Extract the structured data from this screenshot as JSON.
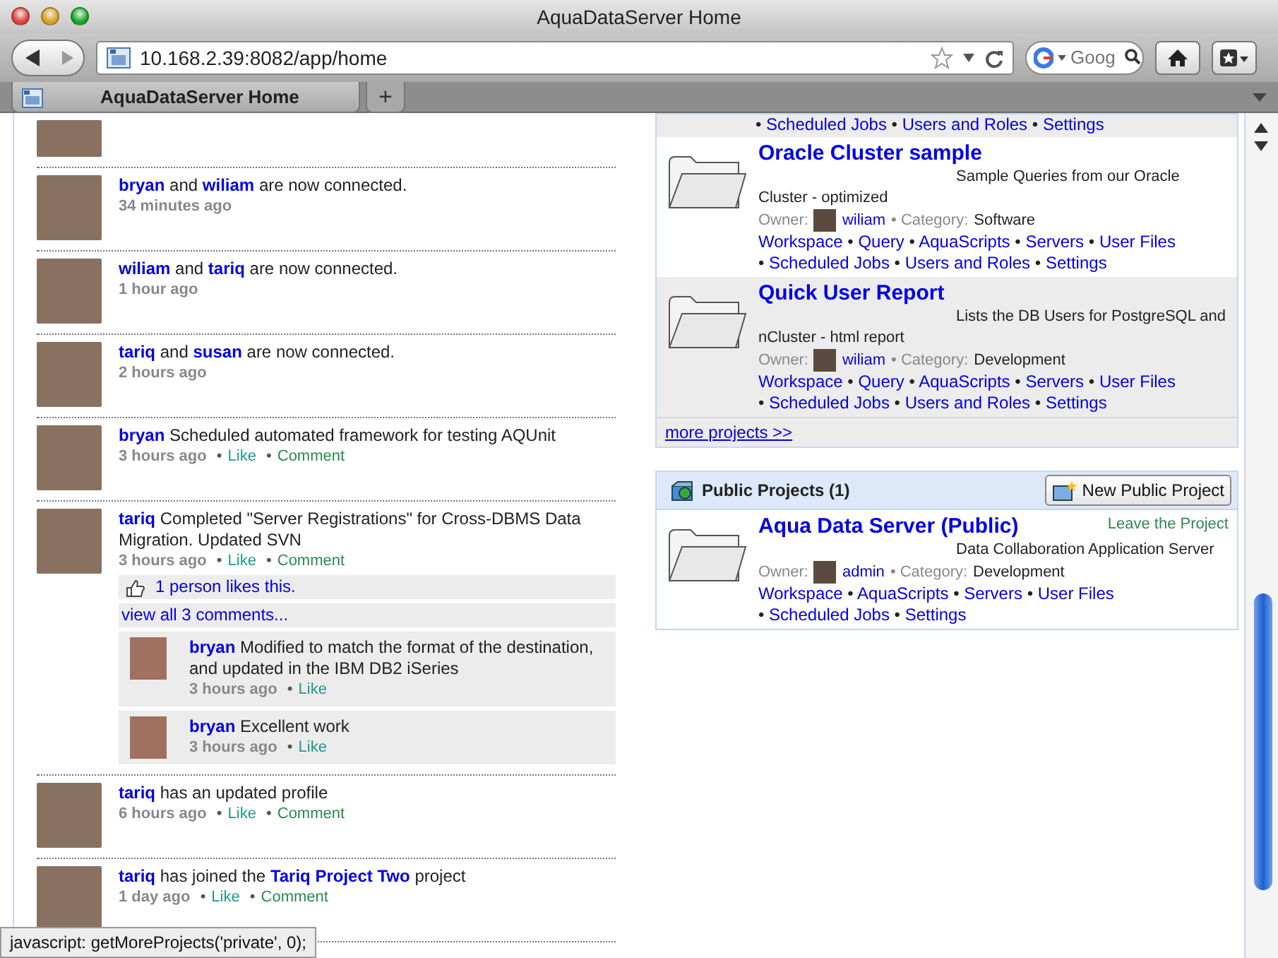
{
  "browser": {
    "title": "AquaDataServer Home",
    "url": "10.168.2.39:8082/app/home",
    "search_placeholder": "Goog",
    "tabs": [
      {
        "label": "AquaDataServer Home",
        "selected": true
      }
    ],
    "new_tab": "+"
  },
  "feed": [
    {
      "kind": "cut"
    },
    {
      "kind": "post",
      "segments": [
        {
          "kind": "user",
          "text": "bryan"
        },
        {
          "kind": "text",
          "text": "and"
        },
        {
          "kind": "user",
          "text": "wiliam"
        },
        {
          "kind": "text",
          "text": "are now connected."
        }
      ],
      "time": "34 minutes ago"
    },
    {
      "kind": "post",
      "segments": [
        {
          "kind": "user",
          "text": "wiliam"
        },
        {
          "kind": "text",
          "text": "and"
        },
        {
          "kind": "user",
          "text": "tariq"
        },
        {
          "kind": "text",
          "text": "are now connected."
        }
      ],
      "time": "1 hour ago"
    },
    {
      "kind": "post",
      "segments": [
        {
          "kind": "user",
          "text": "tariq"
        },
        {
          "kind": "text",
          "text": "and"
        },
        {
          "kind": "user",
          "text": "susan"
        },
        {
          "kind": "text",
          "text": "are now connected."
        }
      ],
      "time": "2 hours ago"
    },
    {
      "kind": "post",
      "segments": [
        {
          "kind": "user",
          "text": "bryan"
        },
        {
          "kind": "text",
          "text": "Scheduled automated framework for testing AQUnit"
        }
      ],
      "time": "3 hours ago",
      "actions": [
        {
          "kind": "like",
          "bullet": "•",
          "text": "Like"
        },
        {
          "kind": "comment",
          "bullet": "•",
          "text": "Comment"
        }
      ]
    },
    {
      "kind": "post",
      "segments": [
        {
          "kind": "user",
          "text": "tariq"
        },
        {
          "kind": "text",
          "text": "Completed \"Server Registrations\" for Cross-DBMS Data Migration. Updated SVN"
        }
      ],
      "time": "3 hours ago",
      "actions": [
        {
          "kind": "like",
          "bullet": "•",
          "text": "Like"
        },
        {
          "kind": "comment",
          "bullet": "•",
          "text": "Comment"
        }
      ],
      "likes": "1 person likes this.",
      "view_all": "view all 3 comments...",
      "comments": [
        {
          "user": "bryan",
          "text": "Modified to match the format of the destination, and updated in the IBM DB2 iSeries",
          "time": "3 hours ago",
          "actions": [
            {
              "kind": "like",
              "bullet": "•",
              "text": "Like"
            }
          ]
        },
        {
          "user": "bryan",
          "text": "Excellent work",
          "time": "3 hours ago",
          "actions": [
            {
              "kind": "like",
              "bullet": "•",
              "text": "Like"
            }
          ]
        }
      ]
    },
    {
      "kind": "post",
      "segments": [
        {
          "kind": "user",
          "text": "tariq"
        },
        {
          "kind": "text",
          "text": "has an updated profile"
        }
      ],
      "time": "6 hours ago",
      "actions": [
        {
          "kind": "like",
          "bullet": "•",
          "text": "Like"
        },
        {
          "kind": "comment",
          "bullet": "•",
          "text": "Comment"
        }
      ]
    },
    {
      "kind": "post",
      "segments": [
        {
          "kind": "user",
          "text": "tariq"
        },
        {
          "kind": "text",
          "text": "has joined the"
        },
        {
          "kind": "project",
          "text": "Tariq Project Two"
        },
        {
          "kind": "text",
          "text": "project"
        }
      ],
      "time": "1 day ago",
      "actions": [
        {
          "kind": "like",
          "bullet": "•",
          "text": "Like"
        },
        {
          "kind": "comment",
          "bullet": "•",
          "text": "Comment"
        }
      ]
    }
  ],
  "private_projects": {
    "cut_links": [
      {
        "bullet": "•",
        "text": "Scheduled Jobs"
      },
      {
        "bullet": "•",
        "text": "Users and Roles"
      },
      {
        "bullet": "•",
        "text": "Settings"
      }
    ],
    "projects": [
      {
        "title": "Oracle Cluster sample",
        "description": "Sample Queries from our Oracle Cluster - optimized",
        "owner_label": "Owner:",
        "owner": "wiliam",
        "category_label": "• Category:",
        "category": "Software",
        "links": [
          {
            "text": "Workspace"
          },
          {
            "bullet": "•",
            "text": "Query"
          },
          {
            "bullet": "•",
            "text": "AquaScripts"
          },
          {
            "bullet": "•",
            "text": "Servers"
          },
          {
            "bullet": "•",
            "text": "User Files"
          },
          {
            "bullet": "•",
            "text": "Scheduled Jobs"
          },
          {
            "bullet": "•",
            "text": "Users and Roles"
          },
          {
            "bullet": "•",
            "text": "Settings"
          }
        ]
      },
      {
        "title": "Quick User Report",
        "description": "Lists the DB Users for PostgreSQL and nCluster - html report",
        "owner_label": "Owner:",
        "owner": "wiliam",
        "category_label": "• Category:",
        "category": "Development",
        "links": [
          {
            "text": "Workspace"
          },
          {
            "bullet": "•",
            "text": "Query"
          },
          {
            "bullet": "•",
            "text": "AquaScripts"
          },
          {
            "bullet": "•",
            "text": "Servers"
          },
          {
            "bullet": "•",
            "text": "User Files"
          },
          {
            "bullet": "•",
            "text": "Scheduled Jobs"
          },
          {
            "bullet": "•",
            "text": "Users and Roles"
          },
          {
            "bullet": "•",
            "text": "Settings"
          }
        ]
      }
    ],
    "more": "more projects >>"
  },
  "public_projects": {
    "title": "Public Projects (1)",
    "new_button": "New Public Project",
    "projects": [
      {
        "title": "Aqua Data Server (Public)",
        "leave": "Leave the Project",
        "description": "Data Collaboration Application Server",
        "owner_label": "Owner:",
        "owner": "admin",
        "category_label": "• Category:",
        "category": "Development",
        "links": [
          {
            "text": "Workspace"
          },
          {
            "bullet": "•",
            "text": "AquaScripts"
          },
          {
            "bullet": "•",
            "text": "Servers"
          },
          {
            "bullet": "•",
            "text": "User Files"
          },
          {
            "bullet": "•",
            "text": "Scheduled Jobs"
          },
          {
            "bullet": "•",
            "text": "Settings"
          }
        ]
      }
    ]
  },
  "status_bar": "javascript: getMoreProjects('private', 0);"
}
